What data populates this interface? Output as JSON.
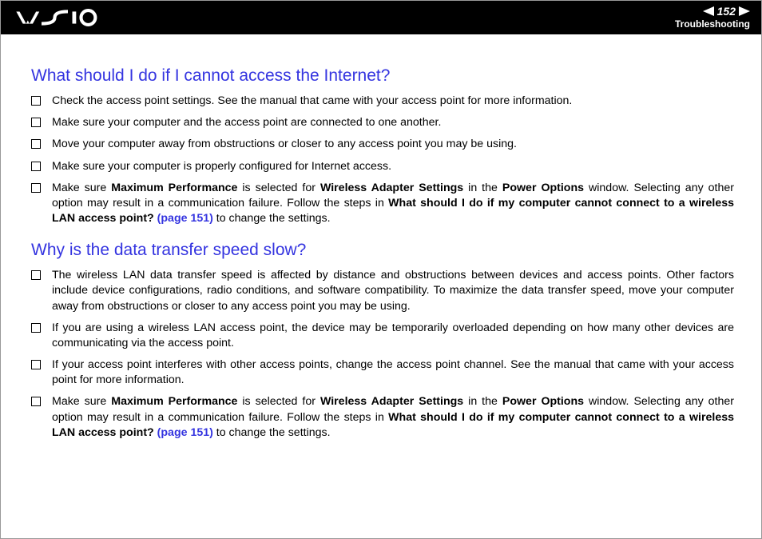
{
  "header": {
    "page_number": "152",
    "section": "Troubleshooting"
  },
  "section1": {
    "heading": "What should I do if I cannot access the Internet?",
    "items": [
      {
        "text": "Check the access point settings. See the manual that came with your access point for more information."
      },
      {
        "text": "Make sure your computer and the access point are connected to one another."
      },
      {
        "text": "Move your computer away from obstructions or closer to any access point you may be using."
      },
      {
        "text": "Make sure your computer is properly configured for Internet access."
      },
      {
        "pre": "Make sure ",
        "b1": "Maximum Performance",
        "mid1": " is selected for ",
        "b2": "Wireless Adapter Settings",
        "mid2": " in the ",
        "b3": "Power Options",
        "mid3": " window. Selecting any other option may result in a communication failure. Follow the steps in ",
        "b4": "What should I do if my computer cannot connect to a wireless LAN access point?",
        "link": " (page 151)",
        "post": " to change the settings."
      }
    ]
  },
  "section2": {
    "heading": "Why is the data transfer speed slow?",
    "items": [
      {
        "text": "The wireless LAN data transfer speed is affected by distance and obstructions between devices and access points. Other factors include device configurations, radio conditions, and software compatibility. To maximize the data transfer speed, move your computer away from obstructions or closer to any access point you may be using."
      },
      {
        "text": "If you are using a wireless LAN access point, the device may be temporarily overloaded depending on how many other devices are communicating via the access point."
      },
      {
        "text": "If your access point interferes with other access points, change the access point channel. See the manual that came with your access point for more information."
      },
      {
        "pre": "Make sure ",
        "b1": "Maximum Performance",
        "mid1": " is selected for ",
        "b2": "Wireless Adapter Settings",
        "mid2": " in the ",
        "b3": "Power Options",
        "mid3": " window. Selecting any other option may result in a communication failure. Follow the steps in ",
        "b4": "What should I do if my computer cannot connect to a wireless LAN access point?",
        "link": " (page 151)",
        "post": " to change the settings."
      }
    ]
  }
}
